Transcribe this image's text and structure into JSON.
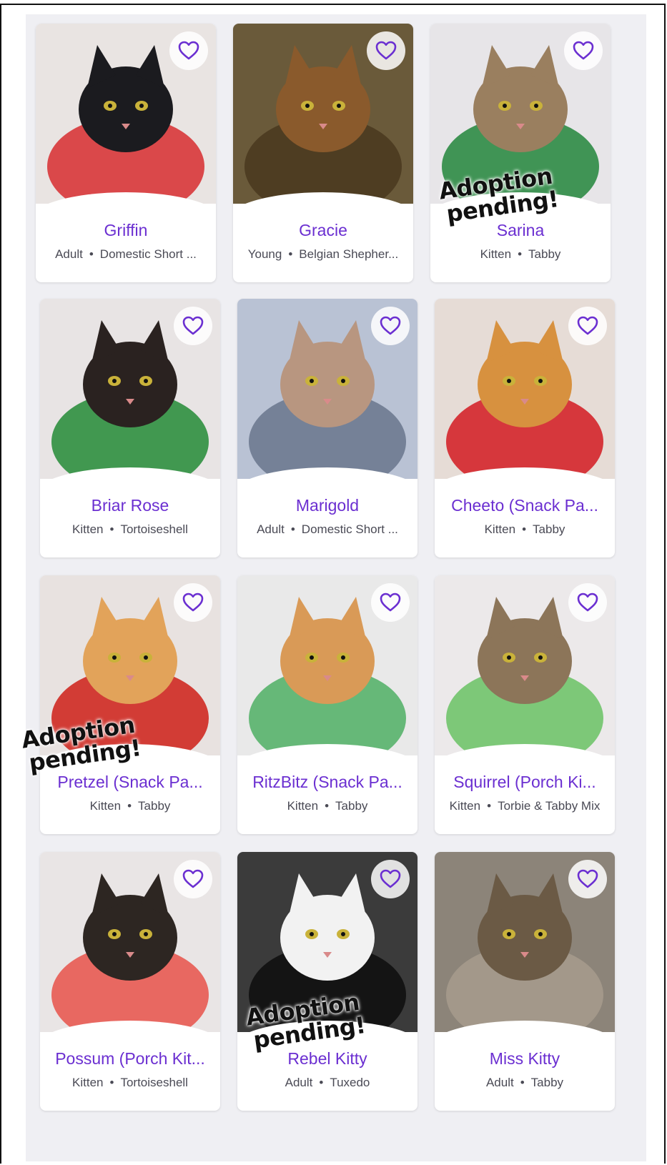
{
  "accent_color": "#6b2fd1",
  "favorite_icon": "heart-outline-icon",
  "pending_label": [
    "Adoption",
    "pending!"
  ],
  "pets": [
    {
      "name": "Griffin",
      "age": "Adult",
      "breed": "Domestic Short ...",
      "pending": false
    },
    {
      "name": "Gracie",
      "age": "Young",
      "breed": "Belgian Shepher...",
      "pending": false
    },
    {
      "name": "Sarina",
      "age": "Kitten",
      "breed": "Tabby",
      "pending": true
    },
    {
      "name": "Briar Rose",
      "age": "Kitten",
      "breed": "Tortoiseshell",
      "pending": false
    },
    {
      "name": "Marigold",
      "age": "Adult",
      "breed": "Domestic Short ...",
      "pending": false
    },
    {
      "name": "Cheeto (Snack Pa...",
      "age": "Kitten",
      "breed": "Tabby",
      "pending": false
    },
    {
      "name": "Pretzel (Snack Pa...",
      "age": "Kitten",
      "breed": "Tabby",
      "pending": true
    },
    {
      "name": "RitzBitz (Snack Pa...",
      "age": "Kitten",
      "breed": "Tabby",
      "pending": false
    },
    {
      "name": "Squirrel (Porch Ki...",
      "age": "Kitten",
      "breed": "Torbie & Tabby Mix",
      "pending": false
    },
    {
      "name": "Possum (Porch Kit...",
      "age": "Kitten",
      "breed": "Tortoiseshell",
      "pending": false
    },
    {
      "name": "Rebel Kitty",
      "age": "Adult",
      "breed": "Tuxedo",
      "pending": true
    },
    {
      "name": "Miss Kitty",
      "age": "Adult",
      "breed": "Tabby",
      "pending": false
    }
  ]
}
